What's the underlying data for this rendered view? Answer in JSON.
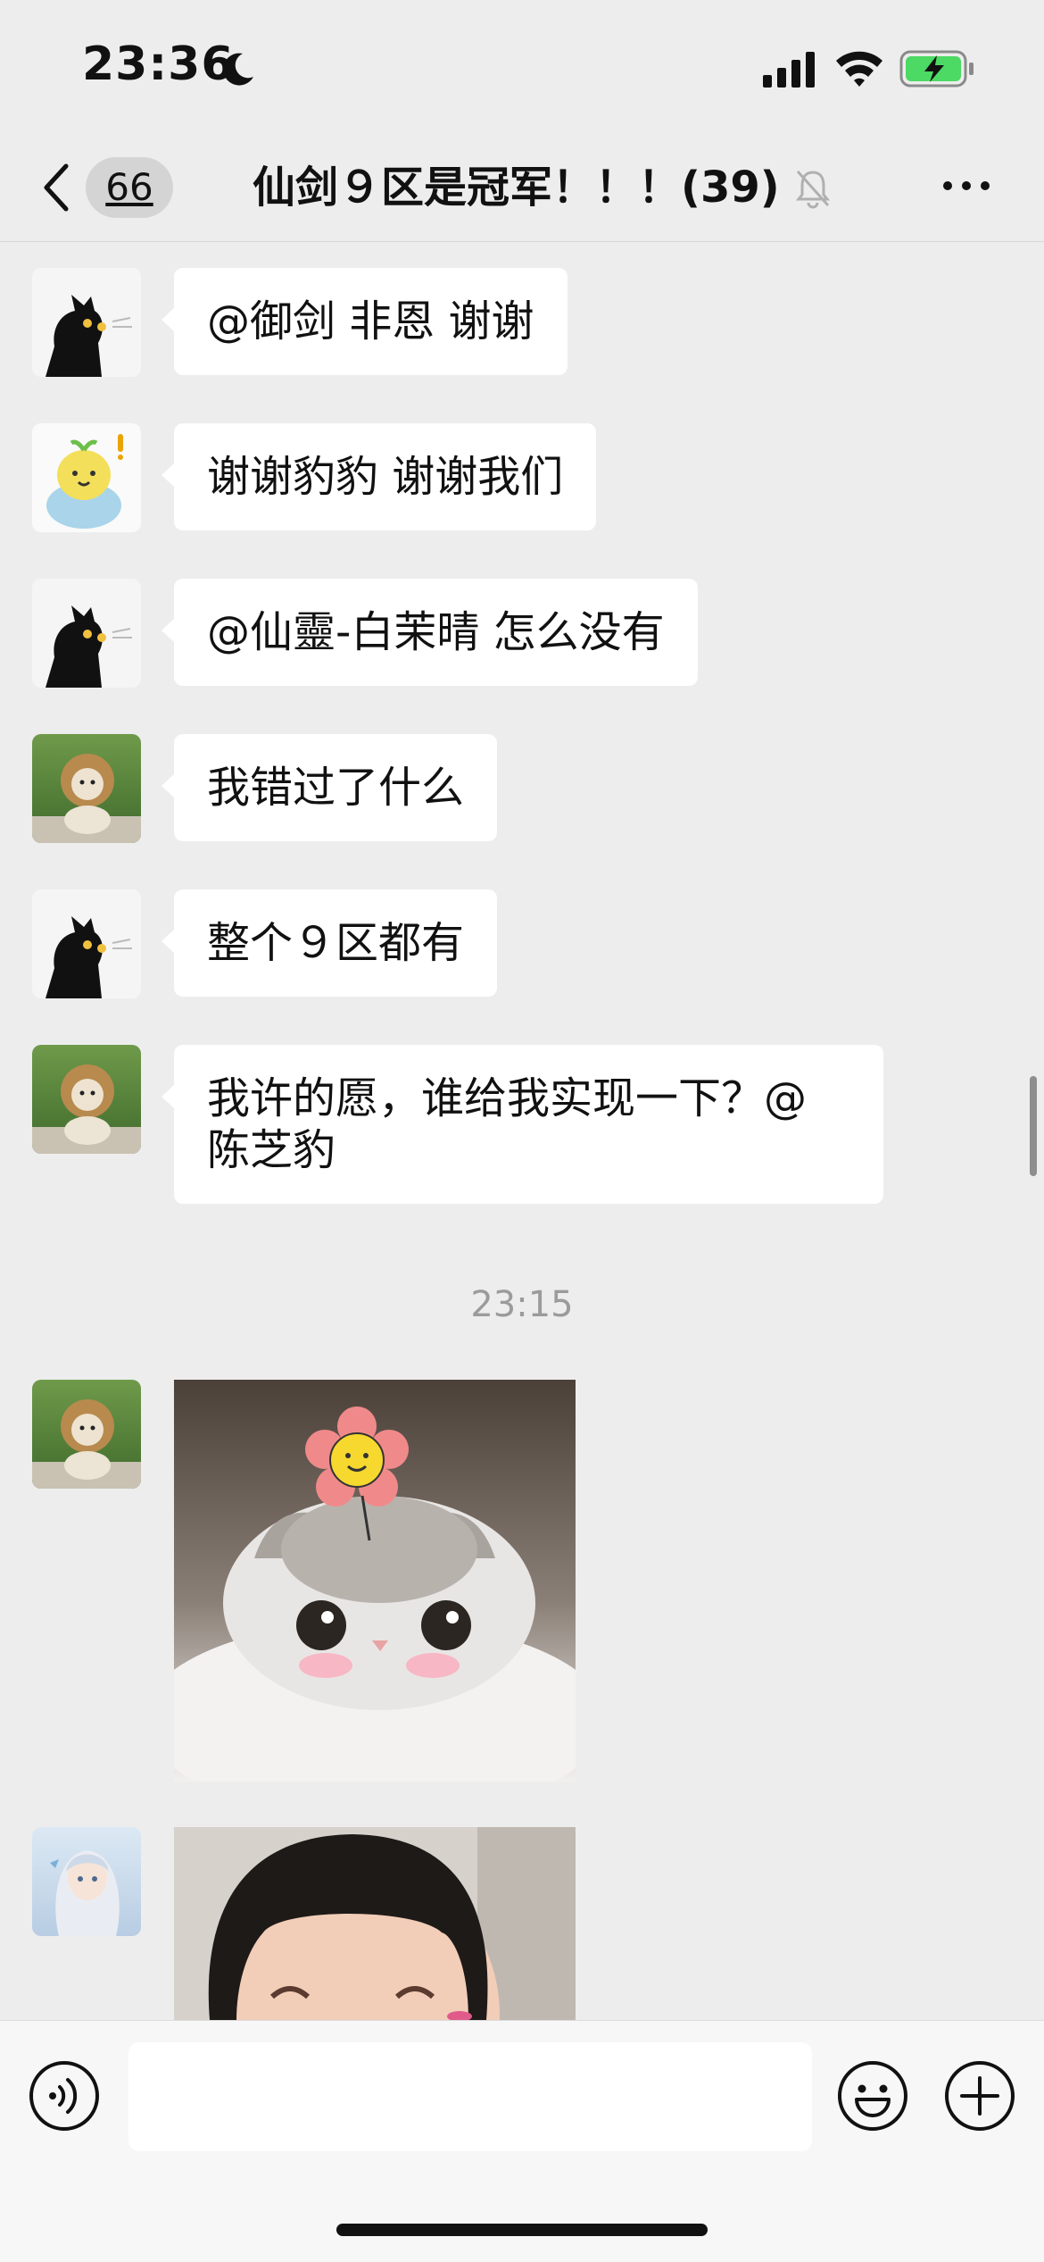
{
  "status_bar": {
    "time": "23:36",
    "icons": [
      "moon-icon",
      "signal-icon",
      "wifi-icon",
      "battery-charging-icon"
    ]
  },
  "nav": {
    "back_count": "66",
    "title": "仙剑９区是冠军！！！(39)",
    "icons": [
      "chevron-left-icon",
      "bell-muted-icon",
      "more-icon"
    ]
  },
  "messages": [
    {
      "avatar": "black-cat-avatar",
      "text": "@御剑 非恩 谢谢"
    },
    {
      "avatar": "cartoon-chick-avatar",
      "text": "谢谢豹豹 谢谢我们"
    },
    {
      "avatar": "black-cat-avatar",
      "text": "@仙靈-白茉晴 怎么没有"
    },
    {
      "avatar": "lion-dog-avatar",
      "text": "我错过了什么"
    },
    {
      "avatar": "black-cat-avatar",
      "text": "整个９区都有"
    },
    {
      "avatar": "lion-dog-avatar",
      "text_line1": "我许的愿，谁给我实现一下？@",
      "text_line2": "陈芝豹"
    }
  ],
  "timestamp": "23:15",
  "image_messages": [
    {
      "avatar": "lion-dog-avatar",
      "image": "kitten-with-flower-sticker"
    },
    {
      "avatar": "anime-girl-avatar",
      "image": "smiling-child-photo"
    }
  ],
  "input_bar": {
    "placeholder": "",
    "icons": [
      "voice-icon",
      "emoji-icon",
      "plus-icon"
    ]
  },
  "colors": {
    "background": "#ededed",
    "bubble": "#ffffff",
    "timestamp": "#9b9b9b",
    "battery": "#4cd964"
  }
}
